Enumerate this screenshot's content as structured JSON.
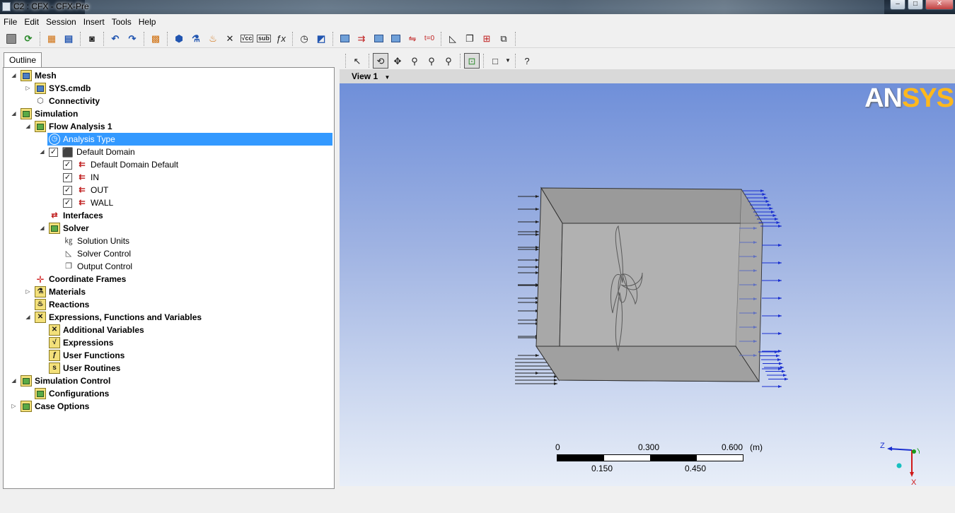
{
  "window": {
    "title": "C2 : CFX - CFX-Pre",
    "buttons": [
      "minimize",
      "maximize",
      "close"
    ]
  },
  "menu": [
    "File",
    "Edit",
    "Session",
    "Insert",
    "Tools",
    "Help"
  ],
  "outline_tab": "Outline",
  "tree": [
    {
      "label": "Mesh",
      "bold": true,
      "level": 0,
      "expander": "open",
      "icon": "mesh-icon"
    },
    {
      "label": "SYS.cmdb",
      "bold": true,
      "level": 1,
      "expander": "closed",
      "icon": "mesh-icon"
    },
    {
      "label": "Connectivity",
      "bold": true,
      "level": 1,
      "expander": "none",
      "icon": "connectivity-icon"
    },
    {
      "label": "Simulation",
      "bold": true,
      "level": 0,
      "expander": "open",
      "icon": "simulation-icon"
    },
    {
      "label": "Flow Analysis 1",
      "bold": true,
      "level": 1,
      "expander": "open",
      "icon": "simulation-icon"
    },
    {
      "label": "Analysis Type",
      "bold": false,
      "level": 2,
      "expander": "none",
      "icon": "clock-icon",
      "selected": true
    },
    {
      "label": "Default Domain",
      "bold": false,
      "level": 2,
      "expander": "open",
      "icon": "domain-icon",
      "checked": true
    },
    {
      "label": "Default Domain Default",
      "bold": false,
      "level": 3,
      "expander": "none",
      "icon": "boundary-icon",
      "checked": true
    },
    {
      "label": "IN",
      "bold": false,
      "level": 3,
      "expander": "none",
      "icon": "boundary-icon",
      "checked": true
    },
    {
      "label": "OUT",
      "bold": false,
      "level": 3,
      "expander": "none",
      "icon": "boundary-icon",
      "checked": true
    },
    {
      "label": "WALL",
      "bold": false,
      "level": 3,
      "expander": "none",
      "icon": "boundary-icon",
      "checked": true
    },
    {
      "label": "Interfaces",
      "bold": true,
      "level": 2,
      "expander": "none",
      "icon": "interfaces-icon"
    },
    {
      "label": "Solver",
      "bold": true,
      "level": 2,
      "expander": "open",
      "icon": "solver-icon"
    },
    {
      "label": "Solution Units",
      "bold": false,
      "level": 3,
      "expander": "none",
      "icon": "units-icon"
    },
    {
      "label": "Solver Control",
      "bold": false,
      "level": 3,
      "expander": "none",
      "icon": "solver-control-icon"
    },
    {
      "label": "Output Control",
      "bold": false,
      "level": 3,
      "expander": "none",
      "icon": "output-control-icon"
    },
    {
      "label": "Coordinate Frames",
      "bold": true,
      "level": 1,
      "expander": "none",
      "icon": "coordinate-frames-icon"
    },
    {
      "label": "Materials",
      "bold": true,
      "level": 1,
      "expander": "closed",
      "icon": "materials-icon"
    },
    {
      "label": "Reactions",
      "bold": true,
      "level": 1,
      "expander": "none",
      "icon": "reactions-icon"
    },
    {
      "label": "Expressions, Functions and Variables",
      "bold": true,
      "level": 1,
      "expander": "open",
      "icon": "expressions-folder-icon"
    },
    {
      "label": "Additional Variables",
      "bold": true,
      "level": 2,
      "expander": "none",
      "icon": "additional-variables-icon"
    },
    {
      "label": "Expressions",
      "bold": true,
      "level": 2,
      "expander": "none",
      "icon": "expressions-icon"
    },
    {
      "label": "User Functions",
      "bold": true,
      "level": 2,
      "expander": "none",
      "icon": "user-functions-icon"
    },
    {
      "label": "User Routines",
      "bold": true,
      "level": 2,
      "expander": "none",
      "icon": "user-routines-icon"
    },
    {
      "label": "Simulation Control",
      "bold": true,
      "level": 0,
      "expander": "open",
      "icon": "simulation-control-icon"
    },
    {
      "label": "Configurations",
      "bold": true,
      "level": 1,
      "expander": "none",
      "icon": "configurations-icon"
    },
    {
      "label": "Case Options",
      "bold": true,
      "level": 0,
      "expander": "closed",
      "icon": "case-options-icon"
    }
  ],
  "viewer": {
    "view_label": "View 1",
    "logo_text_white": "AN",
    "logo_text_yellow": "SYS",
    "scale": {
      "top_labels": [
        "0",
        "0.300",
        "0.600"
      ],
      "bottom_labels": [
        "0.150",
        "0.450"
      ],
      "unit": "(m)"
    },
    "triad": {
      "z": "Z",
      "y": "Y",
      "x": "X"
    }
  }
}
